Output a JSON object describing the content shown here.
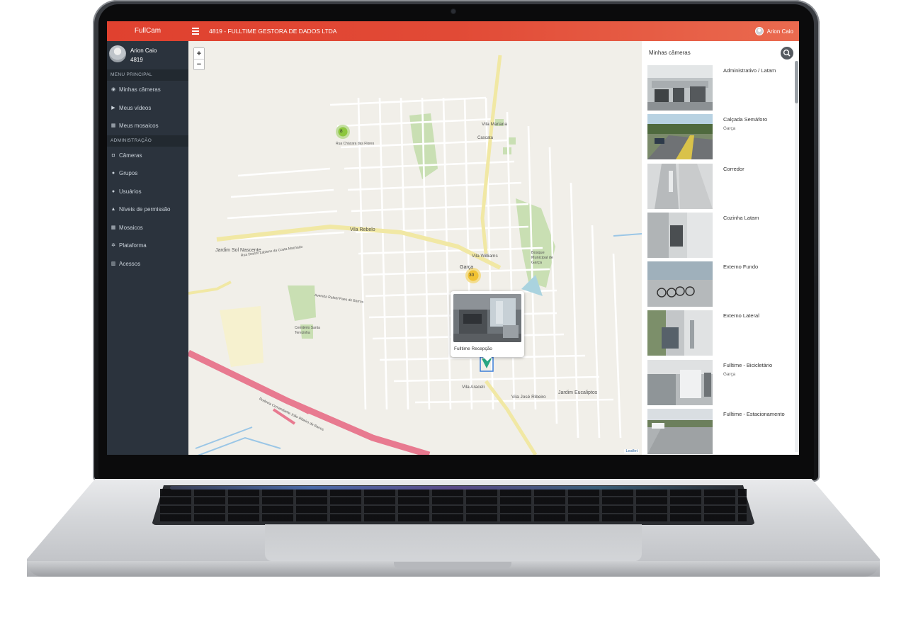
{
  "app": {
    "brand": "FullCam",
    "company": "4819 - FULLTIME GESTORA DE DADOS LTDA"
  },
  "user": {
    "name": "Arion Caio",
    "code": "4819"
  },
  "sidebar": {
    "sections": [
      {
        "title": "MENU PRINCIPAL",
        "items": [
          {
            "label": "Minhas câmeras",
            "icon": "dashboard-icon"
          },
          {
            "label": "Meus vídeos",
            "icon": "play-icon"
          },
          {
            "label": "Meus mosaicos",
            "icon": "grid-icon"
          }
        ]
      },
      {
        "title": "ADMINISTRAÇÃO",
        "items": [
          {
            "label": "Câmeras",
            "icon": "camera-icon"
          },
          {
            "label": "Grupos",
            "icon": "users-icon"
          },
          {
            "label": "Usuários",
            "icon": "user-icon"
          },
          {
            "label": "Níveis de permissão",
            "icon": "lock-icon"
          },
          {
            "label": "Mosaicos",
            "icon": "grid-icon"
          },
          {
            "label": "Plataforma",
            "icon": "cogs-icon"
          },
          {
            "label": "Acessos",
            "icon": "bar-chart-icon"
          }
        ]
      }
    ]
  },
  "map": {
    "zoom_in": "+",
    "zoom_out": "−",
    "attribution": "Leaflet",
    "clusters": [
      {
        "count": "8"
      },
      {
        "count": "30"
      }
    ],
    "places": [
      "Vila Mariana",
      "Vila Rebelo",
      "Jardim Sol Nascente",
      "Vila Williams",
      "Garça",
      "Vila Araceli",
      "Vila José Ribeiro",
      "Jardim Eucaliptos",
      "Cascata",
      "Rua Chácara das Flores",
      "Rua Doutor Labieno da Costa Machado",
      "Rodovia Comandante João Ribeiro de Barros",
      "Bosque Municipal de Garça",
      "Cemitério Santa Terezinha",
      "Avenida Rafael Paes de Barros"
    ],
    "popup": {
      "title": "Fulltime Recepção"
    }
  },
  "cameras": {
    "title": "Minhas câmeras",
    "items": [
      {
        "name": "Administrativo / Latam",
        "location": ""
      },
      {
        "name": "Calçada Semáforo",
        "location": "Garça"
      },
      {
        "name": "Corredor",
        "location": ""
      },
      {
        "name": "Cozinha Latam",
        "location": ""
      },
      {
        "name": "Externo Fundo",
        "location": ""
      },
      {
        "name": "Externo Lateral",
        "location": ""
      },
      {
        "name": "Fulltime - Bicicletário",
        "location": "Garça"
      },
      {
        "name": "Fulltime - Estacionamento",
        "location": ""
      }
    ]
  },
  "colors": {
    "topbar": "#e0412f",
    "sidebar": "#2b333d",
    "cluster_green": "#8cc63e",
    "cluster_yellow": "#f1c232",
    "marker": "#27a582",
    "route_pink": "#e87a90"
  }
}
